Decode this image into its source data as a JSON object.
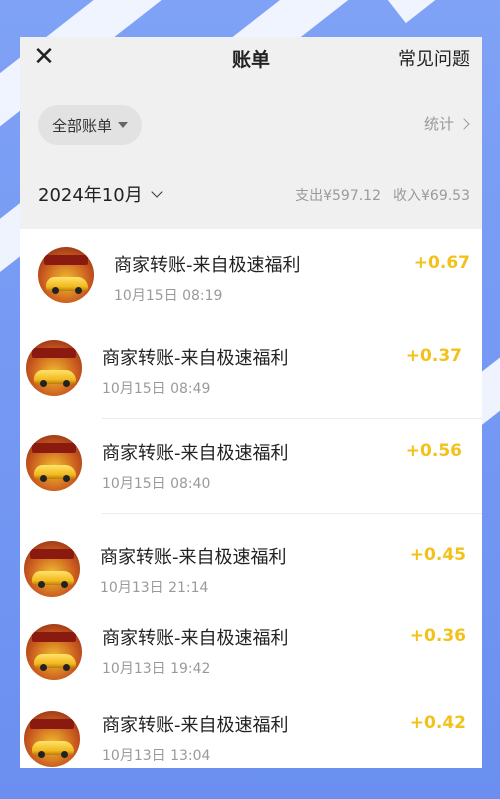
{
  "header": {
    "close_icon": "close-icon",
    "title": "账单",
    "faq_label": "常见问题"
  },
  "filter": {
    "label": "全部账单",
    "stats_label": "统计"
  },
  "month": {
    "label": "2024年10月",
    "expense": "支出¥597.12",
    "income": "收入¥69.53"
  },
  "colors": {
    "amount": "#f3c21a",
    "background": "#6f93f2"
  },
  "transactions": [
    {
      "title": "商家转账-来自极速福利",
      "time": "10月15日 08:19",
      "amount": "+0.67"
    },
    {
      "title": "商家转账-来自极速福利",
      "time": "10月15日 08:49",
      "amount": "+0.37"
    },
    {
      "title": "商家转账-来自极速福利",
      "time": "10月15日 08:40",
      "amount": "+0.56"
    },
    {
      "title": "商家转账-来自极速福利",
      "time": "10月13日 21:14",
      "amount": "+0.45"
    },
    {
      "title": "商家转账-来自极速福利",
      "time": "10月13日 19:42",
      "amount": "+0.36"
    },
    {
      "title": "商家转账-来自极速福利",
      "time": "10月13日 13:04",
      "amount": "+0.42"
    }
  ]
}
